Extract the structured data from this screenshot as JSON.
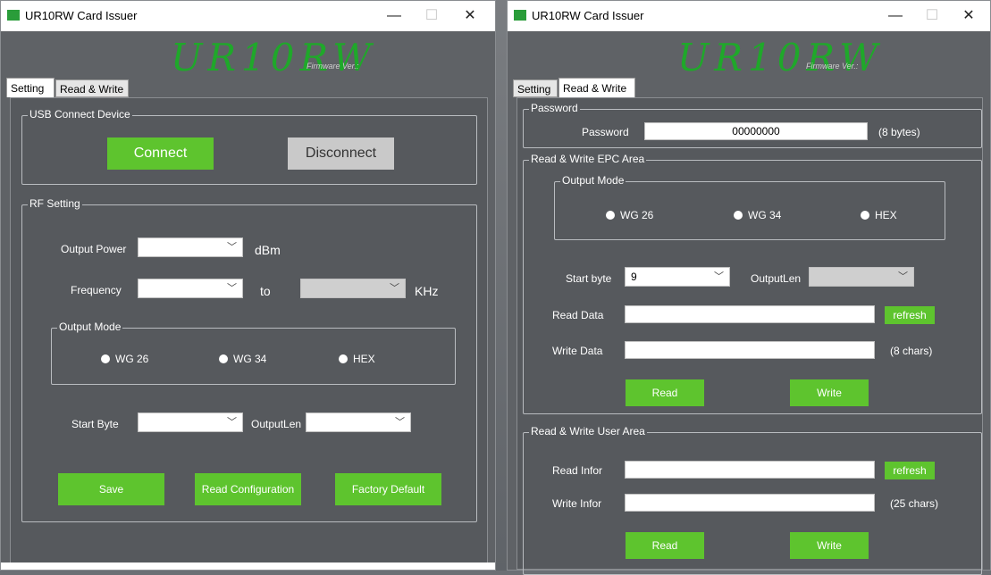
{
  "left": {
    "title": "UR10RW Card Issuer",
    "logo": "UR10RW",
    "firmware_label": "Firmware Ver.:",
    "tabs": [
      "Setting",
      "Read & Write"
    ],
    "usb": {
      "title": "USB Connect Device",
      "connect": "Connect",
      "disconnect": "Disconnect"
    },
    "rf": {
      "title": "RF Setting",
      "output_power_label": "Output Power",
      "output_power_value": "",
      "dbm": "dBm",
      "frequency_label": "Frequency",
      "frequency_from": "",
      "to": "to",
      "frequency_to": "",
      "khz": "KHz",
      "output_mode_title": "Output Mode",
      "modes": [
        "WG 26",
        "WG 34",
        "HEX"
      ],
      "start_byte_label": "Start Byte",
      "start_byte_value": "",
      "outputlen_label": "OutputLen",
      "outputlen_value": "",
      "save": "Save",
      "read_config": "Read Configuration",
      "factory_default": "Factory Default"
    }
  },
  "right": {
    "title": "UR10RW Card Issuer",
    "logo": "UR10RW",
    "firmware_label": "Firmware Ver.:",
    "tabs": [
      "Setting",
      "Read & Write"
    ],
    "password": {
      "title": "Password",
      "label": "Password",
      "value": "00000000",
      "hint": "(8 bytes)"
    },
    "epc": {
      "title": "Read & Write EPC Area",
      "output_mode_title": "Output Mode",
      "modes": [
        "WG 26",
        "WG 34",
        "HEX"
      ],
      "start_byte_label": "Start byte",
      "start_byte_value": "9",
      "outputlen_label": "OutputLen",
      "outputlen_value": "",
      "read_data_label": "Read Data",
      "read_data_value": "",
      "refresh": "refresh",
      "write_data_label": "Write Data",
      "write_data_value": "",
      "write_data_hint": "(8 chars)",
      "read": "Read",
      "write": "Write"
    },
    "user": {
      "title": "Read & Write User Area",
      "read_infor_label": "Read Infor",
      "read_infor_value": "",
      "refresh": "refresh",
      "write_infor_label": "Write Infor",
      "write_infor_value": "",
      "write_infor_hint": "(25 chars)",
      "read": "Read",
      "write": "Write"
    }
  },
  "window_controls": [
    "—",
    "☐",
    "✕"
  ],
  "colors": {
    "accent": "#5ec42e",
    "logo": "#1fa82a",
    "panel": "#56595d",
    "disabled": "#c9c9c9"
  }
}
